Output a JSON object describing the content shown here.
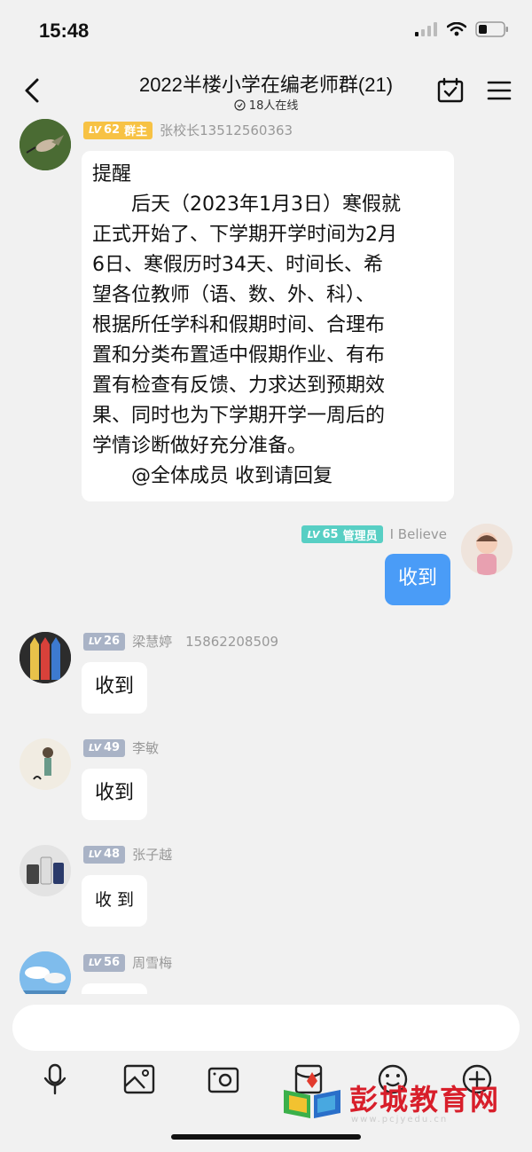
{
  "status_bar": {
    "time": "15:48"
  },
  "header": {
    "title": "2022半楼小学在编老师群(21)",
    "online": "18人在线"
  },
  "messages": [
    {
      "level": "62",
      "role": "群主",
      "sender": "张校长13512560363",
      "text_lines": [
        "提醒",
        "　　后天（2023年1月3日）寒假就",
        "正式开始了、下学期开学时间为2月",
        "6日、寒假历时34天、时间长、希",
        "望各位教师（语、数、外、科）、",
        "根据所任学科和假期时间、合理布",
        "置和分类布置适中假期作业、有布",
        "置有检查有反馈、力求达到预期效",
        "果、同时也为下学期开学一周后的",
        "学情诊断做好充分准备。",
        "　　@全体成员 收到请回复"
      ]
    },
    {
      "level": "65",
      "role": "管理员",
      "sender": "I Believe",
      "text": "收到"
    },
    {
      "level": "26",
      "sender": "梁慧婷　15862208509",
      "text": "收到"
    },
    {
      "level": "49",
      "sender": "李敏",
      "text": "收到"
    },
    {
      "level": "48",
      "sender": "张子越",
      "text": "收 到"
    },
    {
      "level": "56",
      "sender": "周雪梅",
      "text": ""
    }
  ],
  "level_prefix": "LV",
  "colors": {
    "owner_badge": "#f7c244",
    "admin_badge": "#58cfc4",
    "member_badge": "#a9b3c6",
    "my_bubble": "#4a9cf7"
  },
  "toolbar": {
    "icons": [
      "mic-icon",
      "image-icon",
      "camera-icon",
      "red-packet-icon",
      "emoji-icon",
      "plus-icon"
    ]
  },
  "watermark": {
    "text": "彭城教育网",
    "url": "www.pcjyedu.cn"
  }
}
